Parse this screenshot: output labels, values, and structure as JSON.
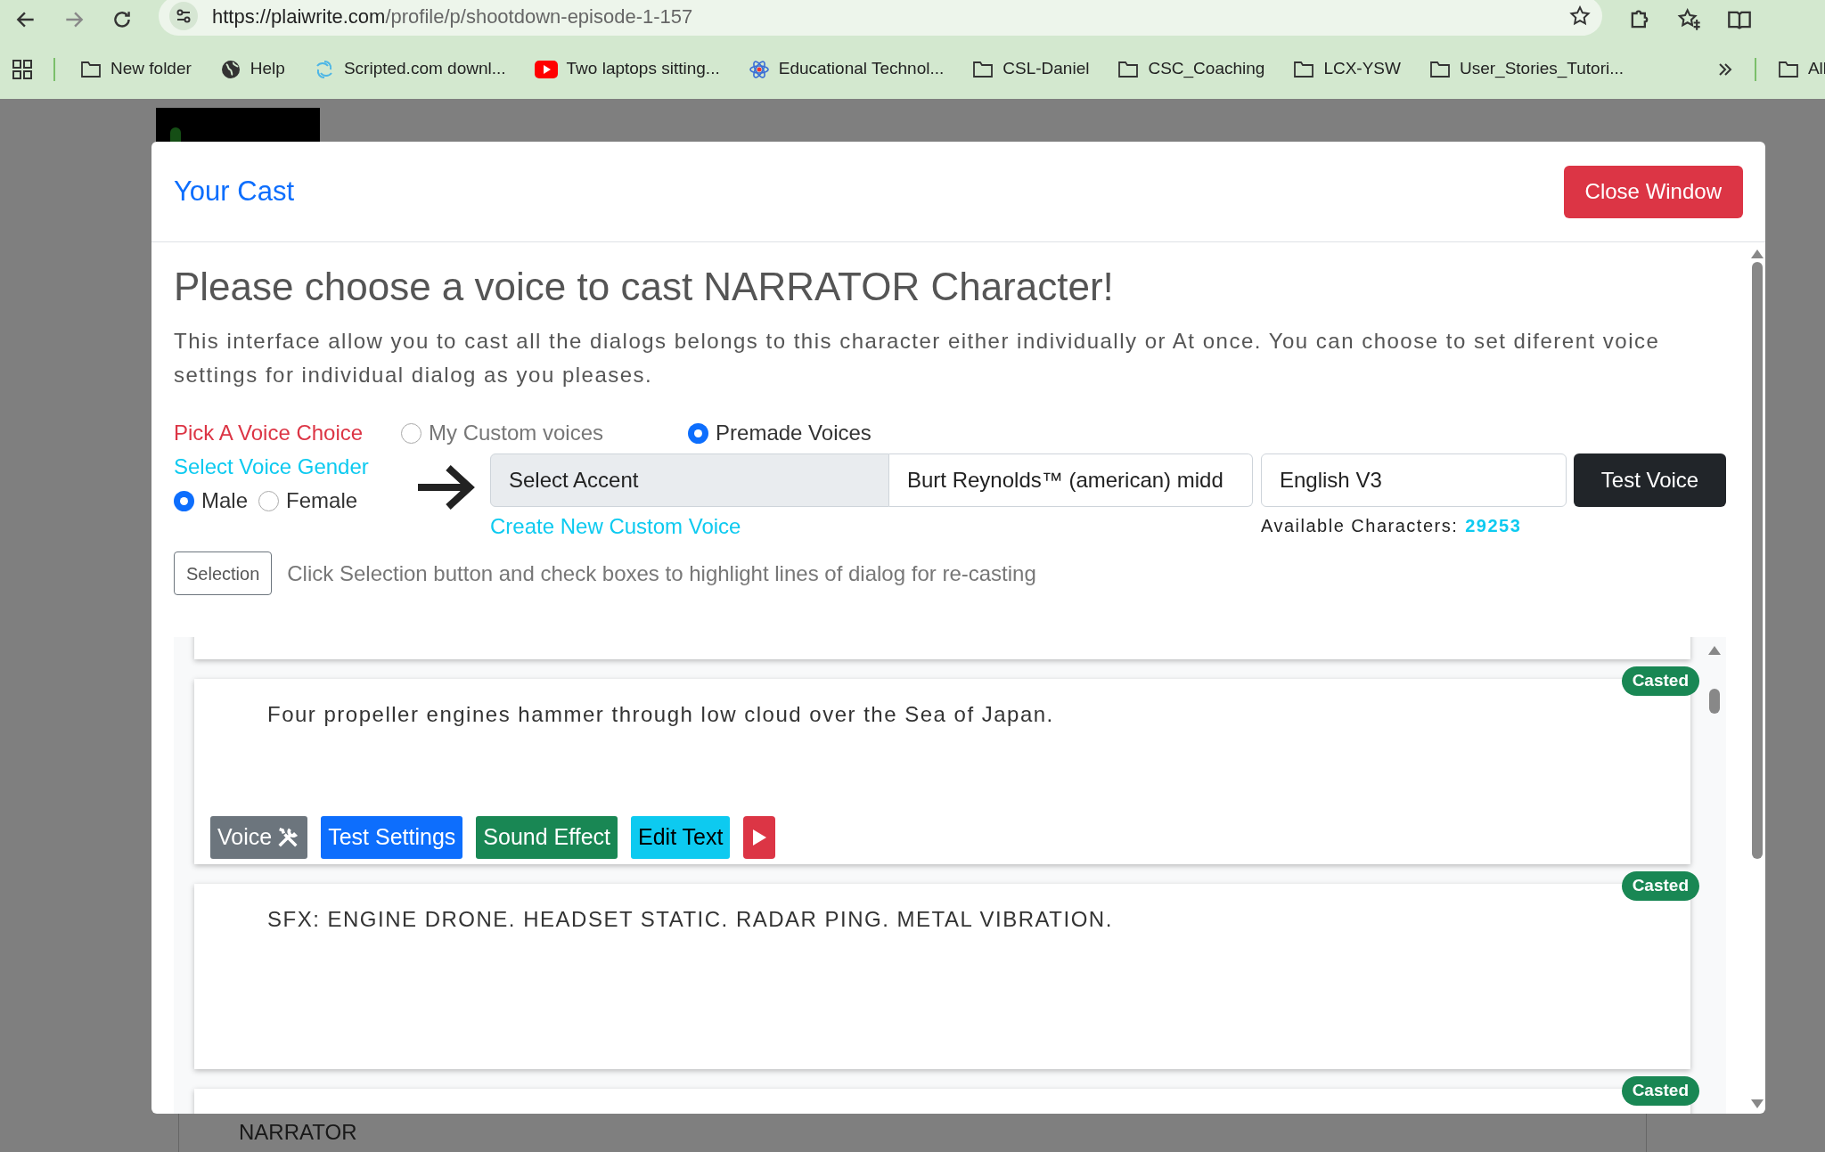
{
  "browser": {
    "url_host": "https://plaiwrite.com",
    "url_path": "/profile/p/shootdown-episode-1-157",
    "bookmarks": [
      {
        "label": "New folder",
        "kind": "folder"
      },
      {
        "label": "Help",
        "kind": "globe"
      },
      {
        "label": "Scripted.com downl...",
        "kind": "swirl"
      },
      {
        "label": "Two laptops sitting...",
        "kind": "video"
      },
      {
        "label": "Educational Technol...",
        "kind": "atom"
      },
      {
        "label": "CSL-Daniel",
        "kind": "folder"
      },
      {
        "label": "CSC_Coaching",
        "kind": "folder"
      },
      {
        "label": "LCX-YSW",
        "kind": "folder"
      },
      {
        "label": "User_Stories_Tutori...",
        "kind": "folder"
      }
    ],
    "other_bookmarks": "All"
  },
  "page": {
    "section_label": "NARRATOR"
  },
  "modal": {
    "title": "Your Cast",
    "close_button": "Close Window",
    "heading": "Please choose a voice to cast NARRATOR Character!",
    "description": "This interface allow you to cast all the dialogs belongs to this character either individually or At once. You can choose to set diferent voice settings for individual dialog as you pleases.",
    "voice_choice": {
      "label": "Pick A Voice Choice",
      "options": [
        {
          "label": "My Custom voices",
          "selected": false
        },
        {
          "label": "Premade Voices",
          "selected": true
        }
      ]
    },
    "gender": {
      "label": "Select Voice Gender",
      "options": [
        {
          "label": "Male",
          "selected": true
        },
        {
          "label": "Female",
          "selected": false
        }
      ]
    },
    "accent_placeholder": "Select Accent",
    "voice_value": "Burt Reynolds™ (american) midd",
    "model_value": "English V3",
    "test_button": "Test Voice",
    "create_link": "Create New Custom Voice",
    "available_label": "Available Characters:",
    "available_count": "29253",
    "selection_button": "Selection",
    "selection_hint": "Click Selection button and check boxes to highlight lines of dialog for re-casting",
    "lines": [
      {
        "kind": "partial"
      },
      {
        "kind": "line",
        "text": "Four propeller engines hammer through low cloud over the Sea of Japan.",
        "status": "Casted",
        "buttons": [
          {
            "kind": "voice",
            "label": "Voice"
          },
          {
            "kind": "test",
            "label": "Test Settings"
          },
          {
            "kind": "sfx",
            "label": "Sound Effect"
          },
          {
            "kind": "edit",
            "label": "Edit Text"
          },
          {
            "kind": "play"
          }
        ]
      },
      {
        "kind": "line",
        "text": "SFX: ENGINE DRONE. HEADSET STATIC. RADAR PING. METAL VIBRATION.",
        "status": "Casted"
      },
      {
        "kind": "line",
        "status": "Casted"
      }
    ]
  }
}
